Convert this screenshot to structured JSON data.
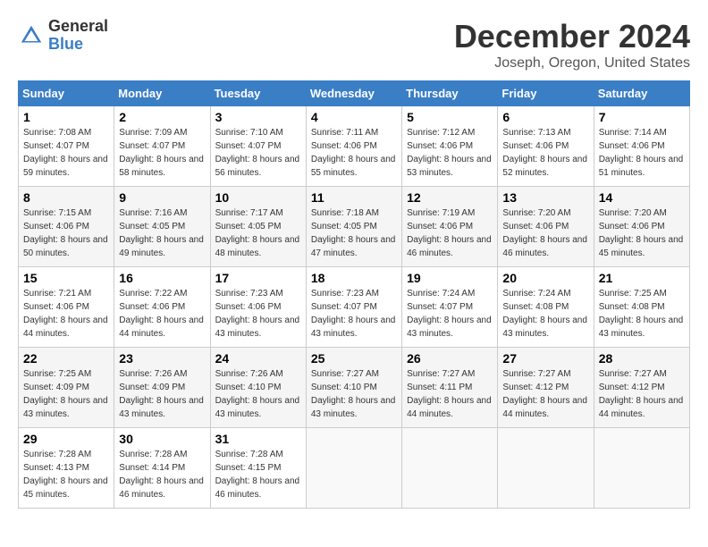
{
  "logo": {
    "general": "General",
    "blue": "Blue"
  },
  "title": "December 2024",
  "location": "Joseph, Oregon, United States",
  "days_of_week": [
    "Sunday",
    "Monday",
    "Tuesday",
    "Wednesday",
    "Thursday",
    "Friday",
    "Saturday"
  ],
  "weeks": [
    [
      {
        "day": "1",
        "sunrise": "7:08 AM",
        "sunset": "4:07 PM",
        "daylight": "8 hours and 59 minutes."
      },
      {
        "day": "2",
        "sunrise": "7:09 AM",
        "sunset": "4:07 PM",
        "daylight": "8 hours and 58 minutes."
      },
      {
        "day": "3",
        "sunrise": "7:10 AM",
        "sunset": "4:07 PM",
        "daylight": "8 hours and 56 minutes."
      },
      {
        "day": "4",
        "sunrise": "7:11 AM",
        "sunset": "4:06 PM",
        "daylight": "8 hours and 55 minutes."
      },
      {
        "day": "5",
        "sunrise": "7:12 AM",
        "sunset": "4:06 PM",
        "daylight": "8 hours and 53 minutes."
      },
      {
        "day": "6",
        "sunrise": "7:13 AM",
        "sunset": "4:06 PM",
        "daylight": "8 hours and 52 minutes."
      },
      {
        "day": "7",
        "sunrise": "7:14 AM",
        "sunset": "4:06 PM",
        "daylight": "8 hours and 51 minutes."
      }
    ],
    [
      {
        "day": "8",
        "sunrise": "7:15 AM",
        "sunset": "4:06 PM",
        "daylight": "8 hours and 50 minutes."
      },
      {
        "day": "9",
        "sunrise": "7:16 AM",
        "sunset": "4:05 PM",
        "daylight": "8 hours and 49 minutes."
      },
      {
        "day": "10",
        "sunrise": "7:17 AM",
        "sunset": "4:05 PM",
        "daylight": "8 hours and 48 minutes."
      },
      {
        "day": "11",
        "sunrise": "7:18 AM",
        "sunset": "4:05 PM",
        "daylight": "8 hours and 47 minutes."
      },
      {
        "day": "12",
        "sunrise": "7:19 AM",
        "sunset": "4:06 PM",
        "daylight": "8 hours and 46 minutes."
      },
      {
        "day": "13",
        "sunrise": "7:20 AM",
        "sunset": "4:06 PM",
        "daylight": "8 hours and 46 minutes."
      },
      {
        "day": "14",
        "sunrise": "7:20 AM",
        "sunset": "4:06 PM",
        "daylight": "8 hours and 45 minutes."
      }
    ],
    [
      {
        "day": "15",
        "sunrise": "7:21 AM",
        "sunset": "4:06 PM",
        "daylight": "8 hours and 44 minutes."
      },
      {
        "day": "16",
        "sunrise": "7:22 AM",
        "sunset": "4:06 PM",
        "daylight": "8 hours and 44 minutes."
      },
      {
        "day": "17",
        "sunrise": "7:23 AM",
        "sunset": "4:06 PM",
        "daylight": "8 hours and 43 minutes."
      },
      {
        "day": "18",
        "sunrise": "7:23 AM",
        "sunset": "4:07 PM",
        "daylight": "8 hours and 43 minutes."
      },
      {
        "day": "19",
        "sunrise": "7:24 AM",
        "sunset": "4:07 PM",
        "daylight": "8 hours and 43 minutes."
      },
      {
        "day": "20",
        "sunrise": "7:24 AM",
        "sunset": "4:08 PM",
        "daylight": "8 hours and 43 minutes."
      },
      {
        "day": "21",
        "sunrise": "7:25 AM",
        "sunset": "4:08 PM",
        "daylight": "8 hours and 43 minutes."
      }
    ],
    [
      {
        "day": "22",
        "sunrise": "7:25 AM",
        "sunset": "4:09 PM",
        "daylight": "8 hours and 43 minutes."
      },
      {
        "day": "23",
        "sunrise": "7:26 AM",
        "sunset": "4:09 PM",
        "daylight": "8 hours and 43 minutes."
      },
      {
        "day": "24",
        "sunrise": "7:26 AM",
        "sunset": "4:10 PM",
        "daylight": "8 hours and 43 minutes."
      },
      {
        "day": "25",
        "sunrise": "7:27 AM",
        "sunset": "4:10 PM",
        "daylight": "8 hours and 43 minutes."
      },
      {
        "day": "26",
        "sunrise": "7:27 AM",
        "sunset": "4:11 PM",
        "daylight": "8 hours and 44 minutes."
      },
      {
        "day": "27",
        "sunrise": "7:27 AM",
        "sunset": "4:12 PM",
        "daylight": "8 hours and 44 minutes."
      },
      {
        "day": "28",
        "sunrise": "7:27 AM",
        "sunset": "4:12 PM",
        "daylight": "8 hours and 44 minutes."
      }
    ],
    [
      {
        "day": "29",
        "sunrise": "7:28 AM",
        "sunset": "4:13 PM",
        "daylight": "8 hours and 45 minutes."
      },
      {
        "day": "30",
        "sunrise": "7:28 AM",
        "sunset": "4:14 PM",
        "daylight": "8 hours and 46 minutes."
      },
      {
        "day": "31",
        "sunrise": "7:28 AM",
        "sunset": "4:15 PM",
        "daylight": "8 hours and 46 minutes."
      },
      null,
      null,
      null,
      null
    ]
  ],
  "labels": {
    "sunrise": "Sunrise:",
    "sunset": "Sunset:",
    "daylight": "Daylight:"
  }
}
